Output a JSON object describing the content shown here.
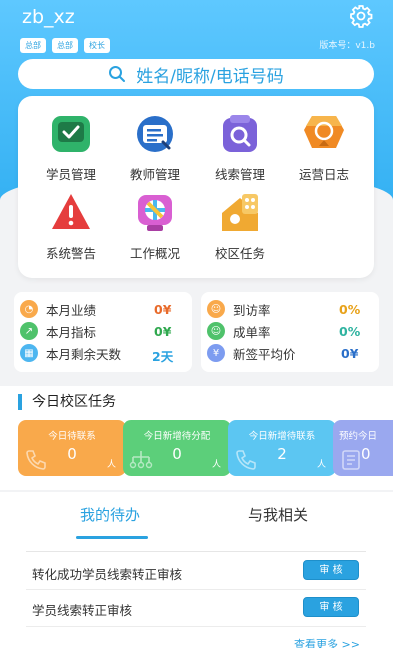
{
  "header": {
    "username": "zb_xz",
    "badges": [
      "总部",
      "总部",
      "校长"
    ],
    "version": "版本号：v1.b",
    "settings_icon": "gear-icon"
  },
  "search": {
    "placeholder": "姓名/昵称/电话号码"
  },
  "grid": {
    "items": [
      {
        "label": "学员管理",
        "icon": "student-icon"
      },
      {
        "label": "教师管理",
        "icon": "teacher-icon"
      },
      {
        "label": "线索管理",
        "icon": "clue-icon"
      },
      {
        "label": "运营日志",
        "icon": "log-icon"
      },
      {
        "label": "系统警告",
        "icon": "warning-icon"
      },
      {
        "label": "工作概况",
        "icon": "overview-icon"
      },
      {
        "label": "校区任务",
        "icon": "campus-task-icon"
      }
    ]
  },
  "stats_left": [
    {
      "label": "本月业绩",
      "value": "0¥"
    },
    {
      "label": "本月指标",
      "value": "0¥"
    },
    {
      "label": "本月剩余天数",
      "value": "2天"
    }
  ],
  "stats_right": [
    {
      "label": "到访率",
      "value": "0%"
    },
    {
      "label": "成单率",
      "value": "0%"
    },
    {
      "label": "新签平均价",
      "value": "0¥"
    }
  ],
  "tasks": {
    "title": "今日校区任务",
    "cards": [
      {
        "title": "今日待联系",
        "value": "0",
        "unit": "人"
      },
      {
        "title": "今日新增待分配",
        "value": "0",
        "unit": "人"
      },
      {
        "title": "今日新增待联系",
        "value": "2",
        "unit": "人"
      },
      {
        "title": "预约今日",
        "value": "0",
        "unit": ""
      }
    ]
  },
  "tabs": {
    "active": "我的待办",
    "other": "与我相关"
  },
  "todos": [
    {
      "text": "转化成功学员线索转正审核",
      "action": "审 核"
    },
    {
      "text": "学员线索转正审核",
      "action": "审 核"
    }
  ],
  "more_link": "查看更多 >>",
  "colors": {
    "accent": "#2aa2e0",
    "orange": "#f9a94b",
    "green": "#5ccf7a",
    "blue": "#5cc6f2",
    "purple": "#9aa8ef"
  }
}
